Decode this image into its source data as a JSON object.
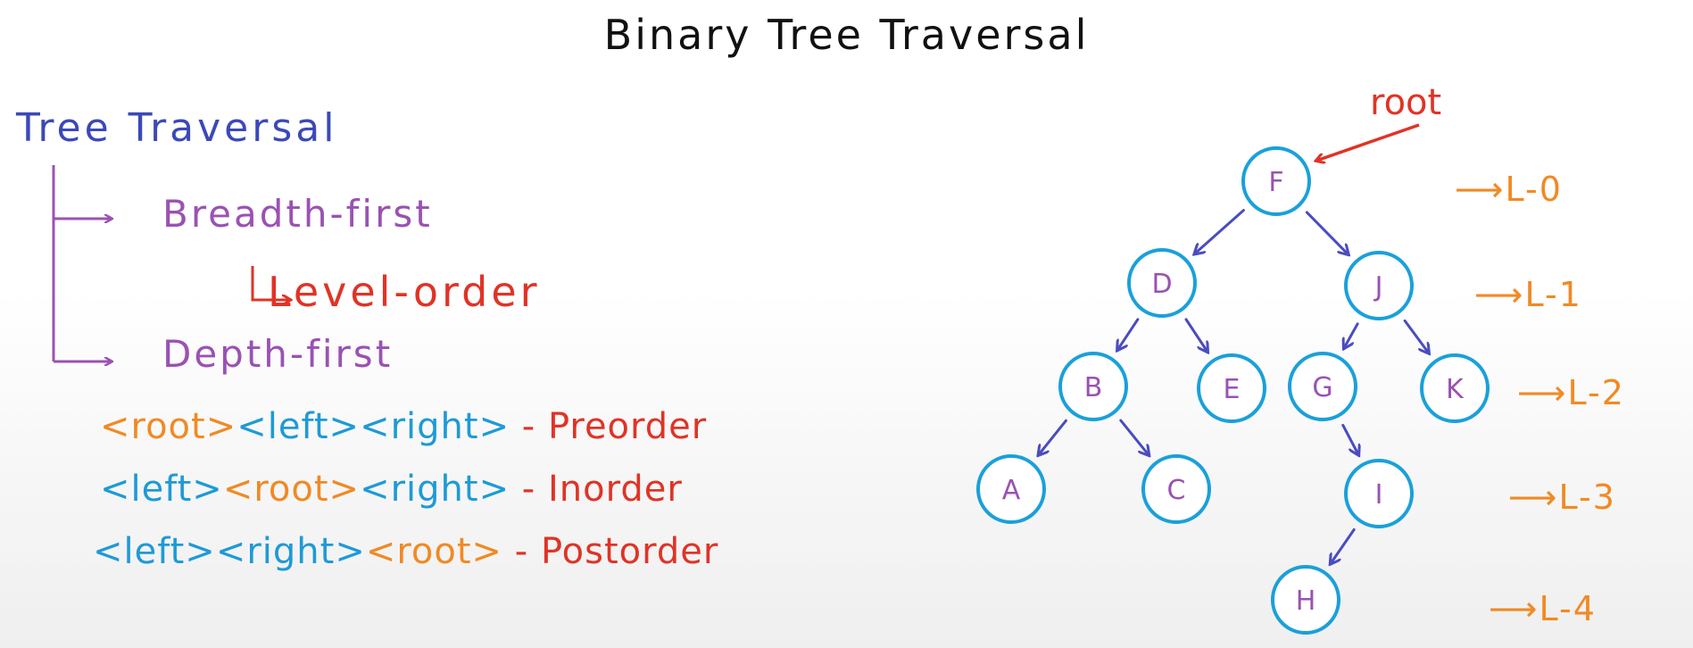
{
  "title": "Binary Tree Traversal",
  "traversal": {
    "heading": "Tree Traversal",
    "breadth_first": "Breadth-first",
    "level_order": "Level-order",
    "depth_first": "Depth-first"
  },
  "orders": [
    {
      "parts": [
        "<root>",
        "<left>",
        "<right>"
      ],
      "dash": "-",
      "name": "Preorder"
    },
    {
      "parts": [
        "<left>",
        "<root>",
        "<right>"
      ],
      "dash": "-",
      "name": "Inorder"
    },
    {
      "parts": [
        "<left>",
        "<right>",
        "<root>"
      ],
      "dash": "-",
      "name": "Postorder"
    }
  ],
  "tree": {
    "root_label": "root",
    "nodes": {
      "F": "F",
      "D": "D",
      "J": "J",
      "B": "B",
      "E": "E",
      "G": "G",
      "K": "K",
      "A": "A",
      "C": "C",
      "I": "I",
      "H": "H"
    },
    "edges": [
      [
        "F",
        "D"
      ],
      [
        "F",
        "J"
      ],
      [
        "D",
        "B"
      ],
      [
        "D",
        "E"
      ],
      [
        "J",
        "G"
      ],
      [
        "J",
        "K"
      ],
      [
        "B",
        "A"
      ],
      [
        "B",
        "C"
      ],
      [
        "G",
        "I"
      ],
      [
        "I",
        "H"
      ]
    ]
  },
  "levels": [
    "L-0",
    "L-1",
    "L-2",
    "L-3",
    "L-4"
  ],
  "colors": {
    "title": "#111111",
    "heading": "#3b49b8",
    "branch": "#9a52b2",
    "level_order": "#e03326",
    "root_token": "#f08a24",
    "left_right_token": "#1e9ad6",
    "order_name": "#e03326",
    "node_circle": "#1aa0da",
    "node_label": "#9a52b2",
    "tree_arrow": "#4a4cc0",
    "root_pointer": "#e03326",
    "level_marker": "#f08a24"
  }
}
